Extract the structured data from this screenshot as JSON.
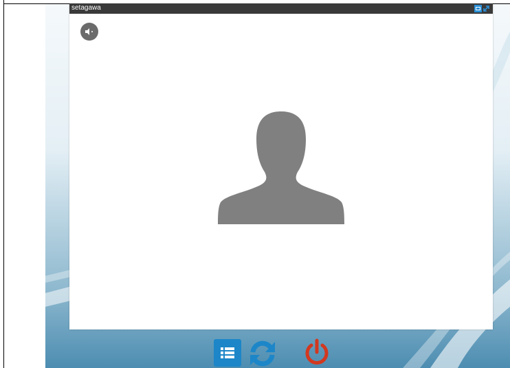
{
  "window": {
    "title": "setagawa"
  },
  "icons": {
    "minimize": "minimize-icon",
    "fullscreen": "fullscreen-icon",
    "speaker": "speaker-icon",
    "avatar": "person-silhouette-icon",
    "list": "list-icon",
    "refresh": "refresh-icon",
    "power": "power-icon"
  },
  "colors": {
    "titlebar": "#3a3a3a",
    "accent_blue": "#1c86c8",
    "power_red": "#d2381f",
    "avatar_gray": "#808080"
  }
}
